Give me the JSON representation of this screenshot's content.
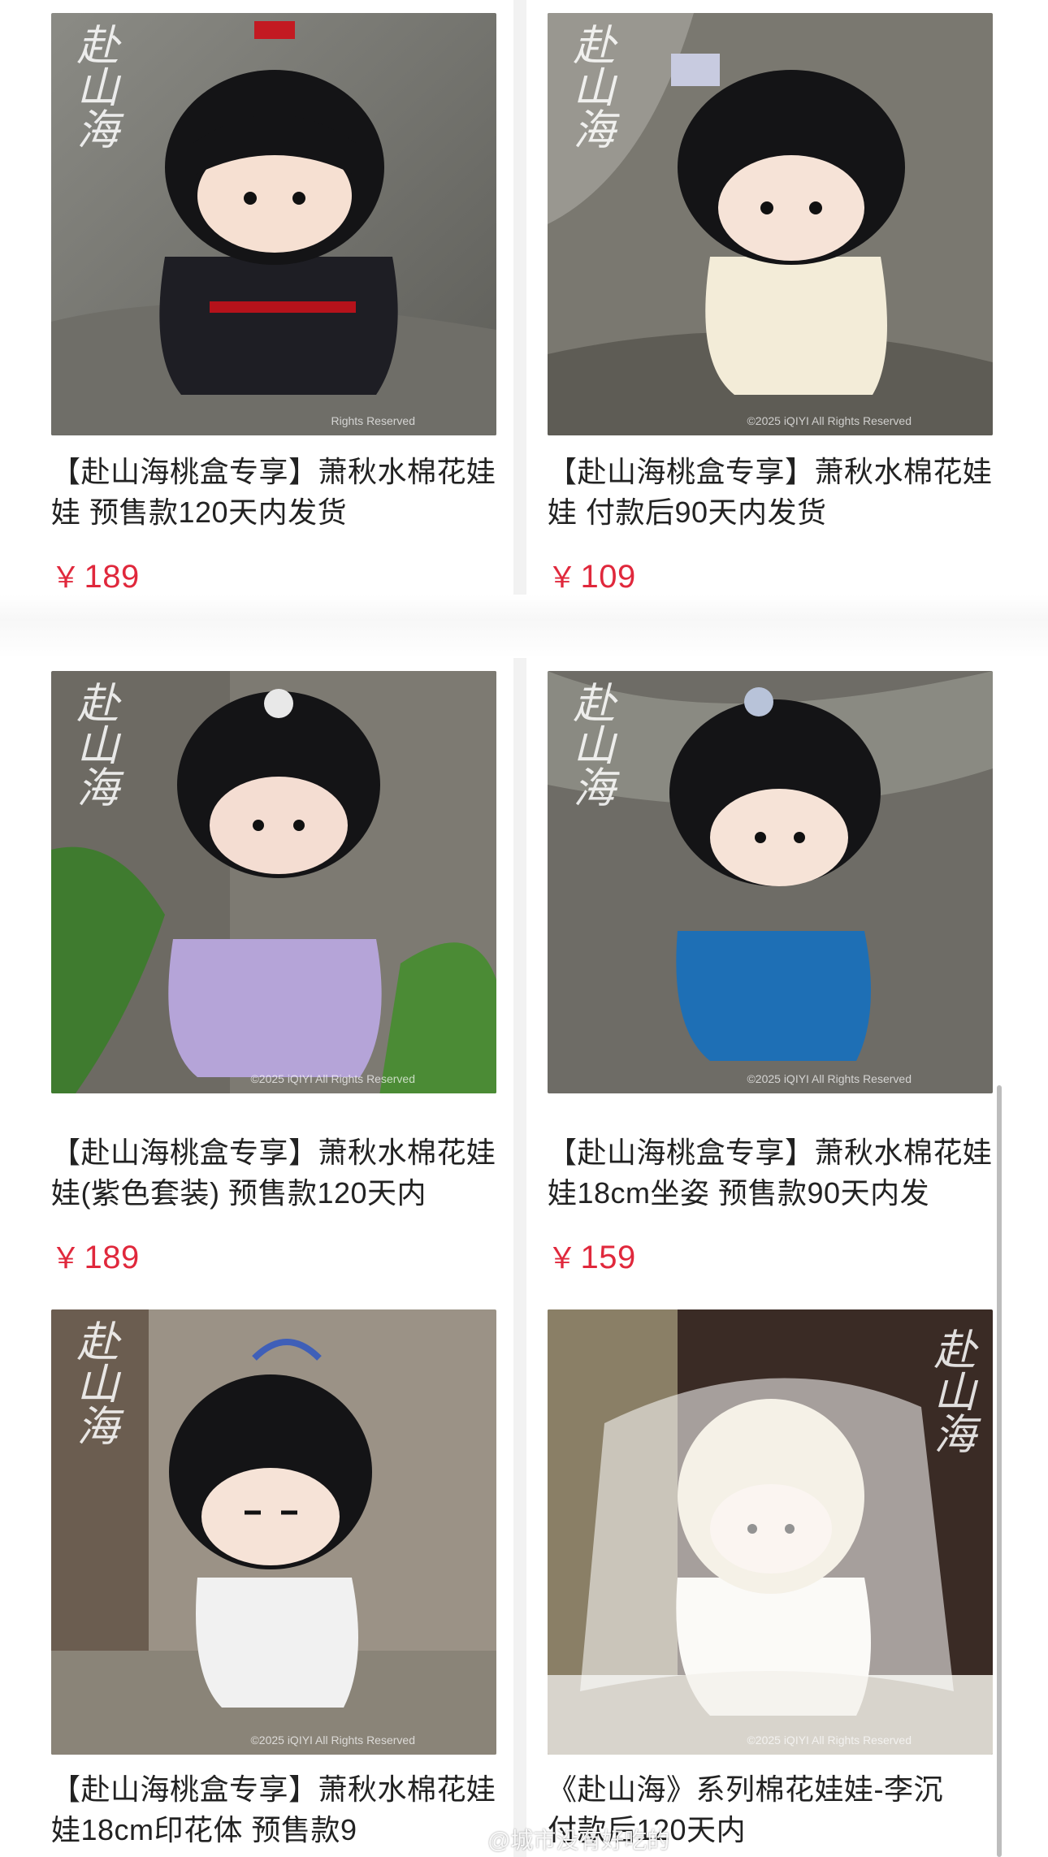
{
  "products": [
    {
      "title": "【赴山海桃盒专享】萧秋水棉花娃娃 预售款120天内发货",
      "price_symbol": "￥",
      "price": "189",
      "watermark": "赴山海",
      "copyright": "Rights Reserved"
    },
    {
      "title": "【赴山海桃盒专享】萧秋水棉花娃娃 付款后90天内发货",
      "price_symbol": "￥",
      "price": "109",
      "watermark": "赴山海",
      "copyright": "©2025 iQIYI All Rights Reserved"
    },
    {
      "title": "【赴山海桃盒专享】萧秋水棉花娃娃(紫色套装) 预售款120天内",
      "price_symbol": "￥",
      "price": "189",
      "watermark": "赴山海",
      "copyright": "©2025 iQIYI All Rights Reserved"
    },
    {
      "title": "【赴山海桃盒专享】萧秋水棉花娃娃18cm坐姿 预售款90天内发",
      "price_symbol": "￥",
      "price": "159",
      "watermark": "赴山海",
      "copyright": "©2025 iQIYI All Rights Reserved"
    },
    {
      "title": "【赴山海桃盒专享】萧秋水棉花娃娃18cm印花体 预售款9",
      "watermark": "赴山海",
      "copyright": "©2025 iQIYI All Rights Reserved"
    },
    {
      "title": "《赴山海》系列棉花娃娃-李沉",
      "title_line2": "付款后120天内",
      "watermark": "赴山海",
      "copyright": "©2025 iQIYI All Rights Reserved"
    }
  ],
  "footer_watermark": "@城市没有好吃的"
}
